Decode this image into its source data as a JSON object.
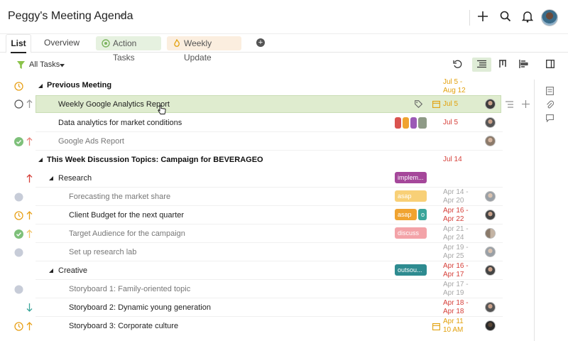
{
  "header": {
    "title": "Peggy's Meeting Agenda"
  },
  "tabs": {
    "list": "List",
    "overview": "Overview",
    "action_tasks": "Action Tasks",
    "weekly_update": "Weekly Update"
  },
  "toolbar": {
    "filter_label": "All Tasks"
  },
  "colors": {
    "accent_green": "#8bc34a",
    "date_red": "#d6403a",
    "date_orange": "#e2a10d",
    "highlight": "#dfeccf"
  },
  "rows": [
    {
      "label": "Previous Meeting",
      "dates": [
        "Jul 5 -",
        "Aug 12"
      ]
    },
    {
      "label": "Weekly Google Analytics Report",
      "dates": [
        "Jul 5"
      ]
    },
    {
      "label": "Data analytics for market conditions",
      "dates": [
        "Jul 5"
      ]
    },
    {
      "label": "Google Ads Report",
      "dates": []
    },
    {
      "label": "This Week Discussion Topics: Campaign for BEVERAGEO",
      "dates": [
        "Jul 14"
      ]
    },
    {
      "label": "Research",
      "tag": "implem...",
      "dates": []
    },
    {
      "label": "Forecasting the market share",
      "tag": "asap",
      "dates": [
        "Apr 14 -",
        "Apr 20"
      ]
    },
    {
      "label": "Client Budget for the next quarter",
      "tag": "asap",
      "tag2": "o",
      "dates": [
        "Apr 16 -",
        "Apr 22"
      ]
    },
    {
      "label": "Target Audience for the campaign",
      "tag": "discuss",
      "dates": [
        "Apr 21 -",
        "Apr 24"
      ]
    },
    {
      "label": "Set up research lab",
      "dates": [
        "Apr 19 -",
        "Apr 25"
      ]
    },
    {
      "label": "Creative",
      "tag": "outsou...",
      "dates": [
        "Apr 16 -",
        "Apr 17"
      ]
    },
    {
      "label": "Storyboard 1: Family-oriented topic",
      "dates": [
        "Apr 17 -",
        "Apr 19"
      ]
    },
    {
      "label": "Storyboard 2: Dynamic young generation",
      "dates": [
        "Apr 18 -",
        "Apr 18"
      ]
    },
    {
      "label": "Storyboard 3: Corporate culture",
      "dates": [
        "Apr 11",
        "10 AM"
      ]
    }
  ]
}
